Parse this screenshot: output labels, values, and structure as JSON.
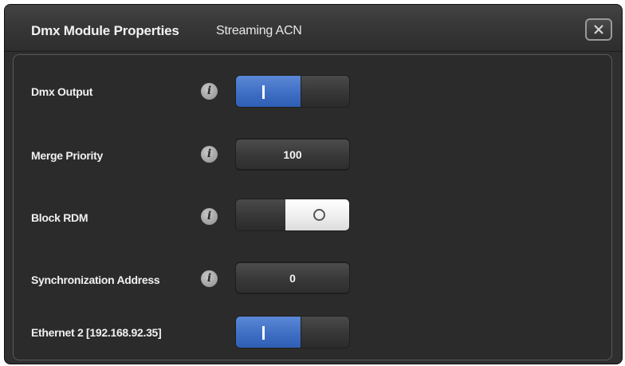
{
  "dialog": {
    "title": "Dmx Module Properties",
    "subtitle": "Streaming ACN",
    "close_icon": "close-icon"
  },
  "rows": [
    {
      "label": "Dmx Output",
      "has_info": true,
      "control": "toggle",
      "state": "on"
    },
    {
      "label": "Merge Priority",
      "has_info": true,
      "control": "button",
      "value": "100"
    },
    {
      "label": "Block RDM",
      "has_info": true,
      "control": "toggle",
      "state": "off"
    },
    {
      "label": "Synchronization Address",
      "has_info": true,
      "control": "button",
      "value": "0"
    },
    {
      "label": "Ethernet 2 [192.168.92.35]",
      "has_info": false,
      "control": "toggle",
      "state": "on"
    }
  ],
  "info_glyph": "i",
  "colors": {
    "accent_on": "#3f6fc4",
    "background": "#2f2f2f",
    "off_segment": "#ededed"
  }
}
